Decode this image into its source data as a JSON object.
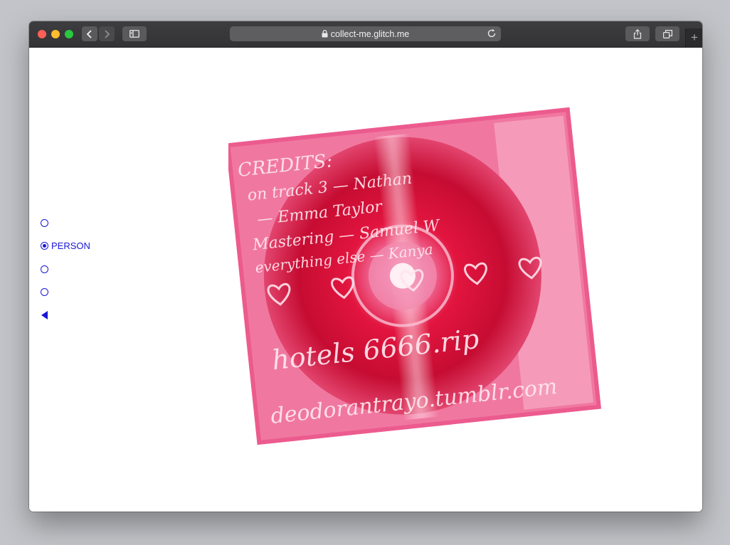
{
  "browser": {
    "url": "collect-me.glitch.me"
  },
  "colors": {
    "accent": "#1a16d8",
    "cd_pink": "#f27aa6",
    "cd_red": "#e2153f"
  },
  "menu": {
    "items": [
      {
        "label": "",
        "selected": false
      },
      {
        "label": "PERSON",
        "selected": true
      },
      {
        "label": "",
        "selected": false
      },
      {
        "label": "",
        "selected": false
      }
    ],
    "back_icon": "back-triangle-icon"
  },
  "artwork": {
    "handwriting": {
      "line1": "CREDITS:",
      "line2": "on track 3 — Nathan",
      "line3": "— Emma Taylor",
      "line4": "Mastering — Samuel W",
      "line5": "everything else — Kanya",
      "line6": "hotels 6666.rip",
      "line7": "deodorantrayo.tumblr.com"
    }
  }
}
